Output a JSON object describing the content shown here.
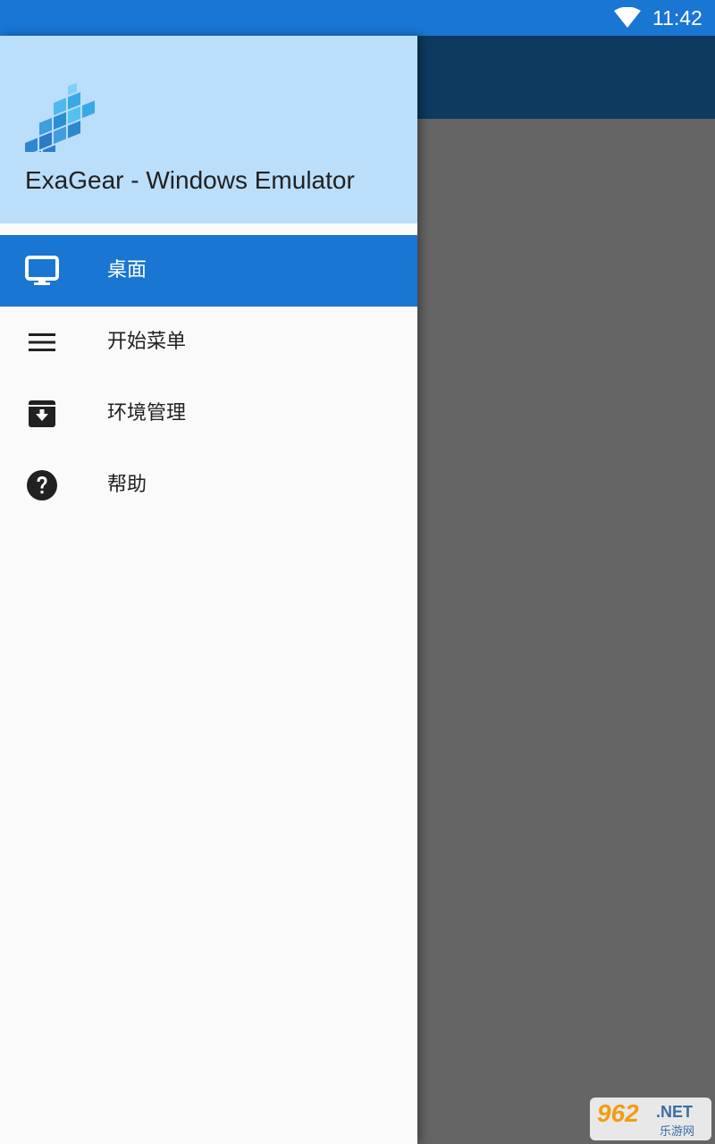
{
  "status_bar": {
    "time": "11:42",
    "wifi_icon": "wifi-icon"
  },
  "drawer": {
    "app_name": "ExaGear - Windows Emulator",
    "logo_icon": "exagear-logo",
    "header_color": "#bbdefb",
    "items": [
      {
        "label": "桌面",
        "icon": "desktop-monitor-icon",
        "active": true
      },
      {
        "label": "开始菜单",
        "icon": "menu-lines-icon",
        "active": false
      },
      {
        "label": "环境管理",
        "icon": "archive-box-icon",
        "active": false
      },
      {
        "label": "帮助",
        "icon": "help-circle-icon",
        "active": false
      }
    ]
  },
  "colors": {
    "accent": "#1976d2",
    "toolbar_dim": "#0d3a5e",
    "scrim": "#646464"
  },
  "watermark": {
    "number": "962",
    "domain": ".NET",
    "site_name": "乐游网"
  }
}
